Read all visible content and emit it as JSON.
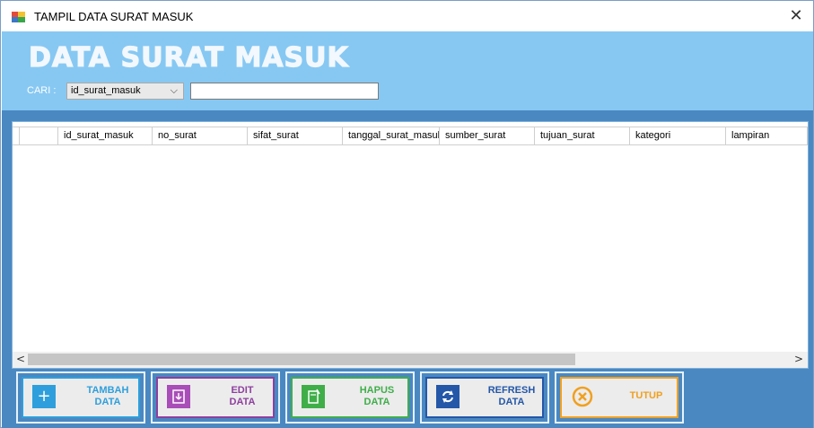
{
  "window": {
    "title": "TAMPIL DATA  SURAT MASUK",
    "close_glyph": "✕"
  },
  "header": {
    "heading": "DATA  SURAT MASUK",
    "search_label": "CARI :",
    "search_field_selected": "id_surat_masuk",
    "search_value": ""
  },
  "grid": {
    "columns": [
      "id_surat_masuk",
      "no_surat",
      "sifat_surat",
      "tanggal_surat_masuk",
      "sumber_surat",
      "tujuan_surat",
      "kategori",
      "lampiran"
    ],
    "rows": []
  },
  "buttons": {
    "tambah": {
      "line1": "TAMBAH",
      "line2": "DATA",
      "icon": "plus-icon",
      "color": "#2e9fdc"
    },
    "edit": {
      "line1": "EDIT",
      "line2": "DATA",
      "icon": "edit-icon",
      "color": "#8e3f9e"
    },
    "hapus": {
      "line1": "HAPUS",
      "line2": "DATA",
      "icon": "delete-icon",
      "color": "#3fae49"
    },
    "refresh": {
      "line1": "REFRESH",
      "line2": "DATA",
      "icon": "refresh-icon",
      "color": "#2457a8"
    },
    "tutup": {
      "line1": "TUTUP",
      "icon": "close-circle-icon",
      "color": "#f0a020"
    }
  },
  "colors": {
    "header_bg": "#87c8f3",
    "frame_bg": "#4a88c2"
  }
}
